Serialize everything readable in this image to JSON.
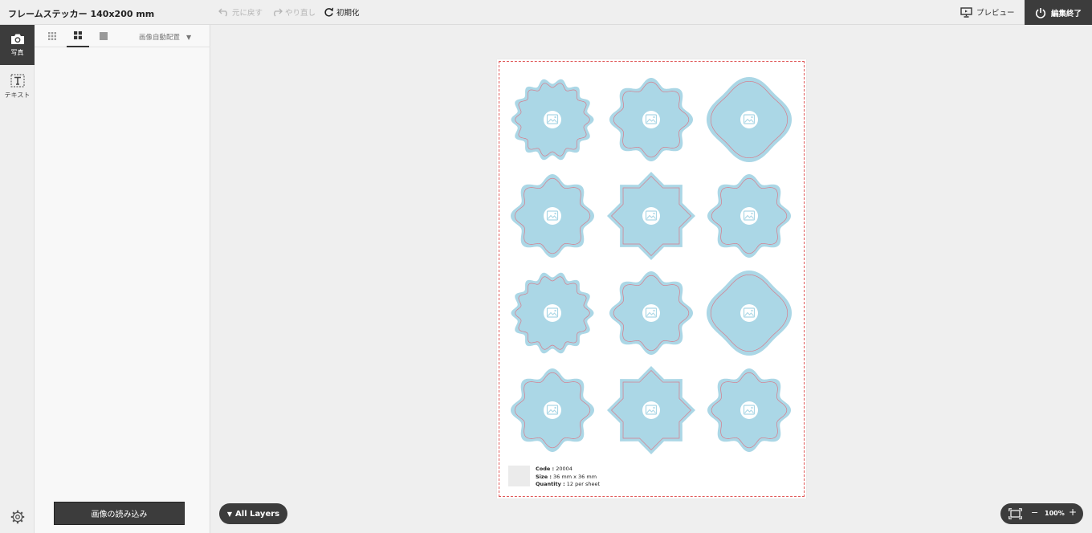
{
  "header": {
    "title": "フレームステッカー 140x200 mm",
    "undo_label": "元に戻す",
    "redo_label": "やり直し",
    "reset_label": "初期化",
    "preview_label": "プレビュー",
    "finish_label": "編集終了"
  },
  "rail": {
    "photo_label": "写真",
    "text_label": "テキスト"
  },
  "panel": {
    "auto_layout_label": "画像自動配置",
    "load_button_label": "画像の読み込み"
  },
  "sheet": {
    "sticker_shapes": [
      "scallop-fine",
      "flower-8",
      "quatrefoil",
      "flower-8",
      "star-8",
      "flower-8",
      "scallop-fine",
      "flower-8",
      "quatrefoil",
      "flower-8",
      "star-8",
      "flower-8"
    ],
    "colors": {
      "sticker_fill": "#abd7e6",
      "cut_line": "#d77b8a",
      "icon_circle": "#ffffff",
      "icon_stroke": "#abd7e6",
      "bleed_border": "#e05a5a"
    },
    "info": {
      "code_label": "Code :",
      "code_value": "20004",
      "size_label": "Size :",
      "size_value": "36 mm x 36 mm",
      "qty_label": "Quantity :",
      "qty_value": "12 per sheet"
    }
  },
  "footer": {
    "layers_label": "All Layers",
    "zoom_value": "100%",
    "zoom_minus": "−",
    "zoom_plus": "+"
  }
}
